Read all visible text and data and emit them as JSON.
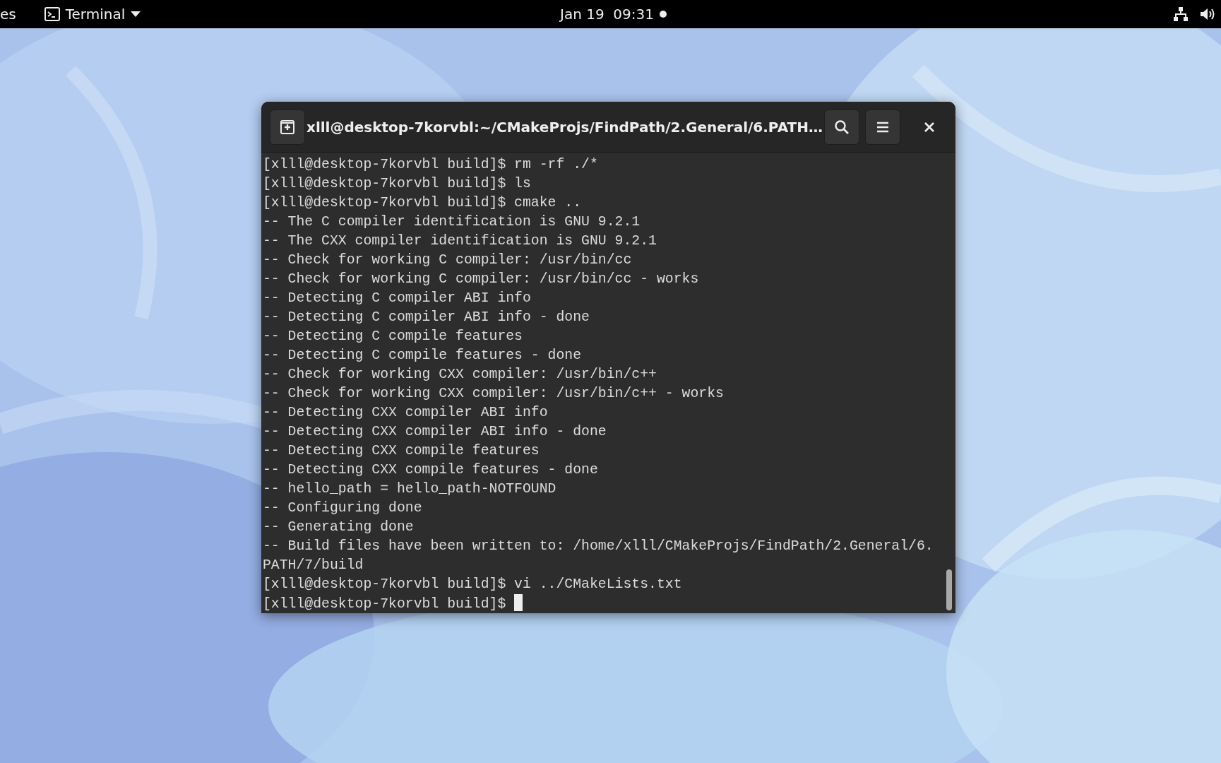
{
  "top_bar": {
    "activities": "es",
    "app_menu": "Terminal",
    "clock": "Jan 19  09:31"
  },
  "terminal": {
    "title": "xlll@desktop-7korvbl:~/CMakeProjs/FindPath/2.General/6.PATH…",
    "lines": [
      "[xlll@desktop-7korvbl build]$ rm -rf ./*",
      "[xlll@desktop-7korvbl build]$ ls",
      "[xlll@desktop-7korvbl build]$ cmake ..",
      "-- The C compiler identification is GNU 9.2.1",
      "-- The CXX compiler identification is GNU 9.2.1",
      "-- Check for working C compiler: /usr/bin/cc",
      "-- Check for working C compiler: /usr/bin/cc - works",
      "-- Detecting C compiler ABI info",
      "-- Detecting C compiler ABI info - done",
      "-- Detecting C compile features",
      "-- Detecting C compile features - done",
      "-- Check for working CXX compiler: /usr/bin/c++",
      "-- Check for working CXX compiler: /usr/bin/c++ - works",
      "-- Detecting CXX compiler ABI info",
      "-- Detecting CXX compiler ABI info - done",
      "-- Detecting CXX compile features",
      "-- Detecting CXX compile features - done",
      "-- hello_path = hello_path-NOTFOUND",
      "-- Configuring done",
      "-- Generating done",
      "-- Build files have been written to: /home/xlll/CMakeProjs/FindPath/2.General/6.",
      "PATH/7/build",
      "[xlll@desktop-7korvbl build]$ vi ../CMakeLists.txt"
    ],
    "prompt": "[xlll@desktop-7korvbl build]$"
  }
}
